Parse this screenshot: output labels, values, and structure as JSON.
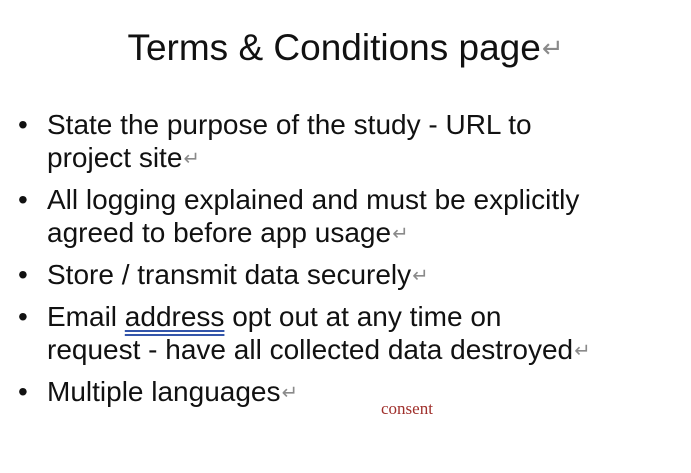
{
  "title": {
    "text": "Terms & Conditions page",
    "mark": "↵"
  },
  "bullets": [
    {
      "lines": [
        "State the purpose of the study - URL to",
        "project site"
      ],
      "mark": "↵"
    },
    {
      "lines": [
        "All logging explained and must be explicitly",
        "agreed to before app usage"
      ],
      "mark": "↵"
    },
    {
      "lines": [
        "Store / transmit data securely"
      ],
      "mark": "↵"
    },
    {
      "line1_before": "Email ",
      "line1_underlined": "address",
      "line1_after": " opt out at any time on",
      "line2": "request - have all collected data destroyed",
      "mark": "↵"
    },
    {
      "lines": [
        "Multiple languages"
      ],
      "mark": "↵"
    }
  ],
  "bullet_symbol": "•",
  "annotation": "consent",
  "colors": {
    "text": "#111111",
    "paragraph_mark": "#8a8a8a",
    "underline": "#3355aa",
    "annotation": "#a0302c"
  }
}
